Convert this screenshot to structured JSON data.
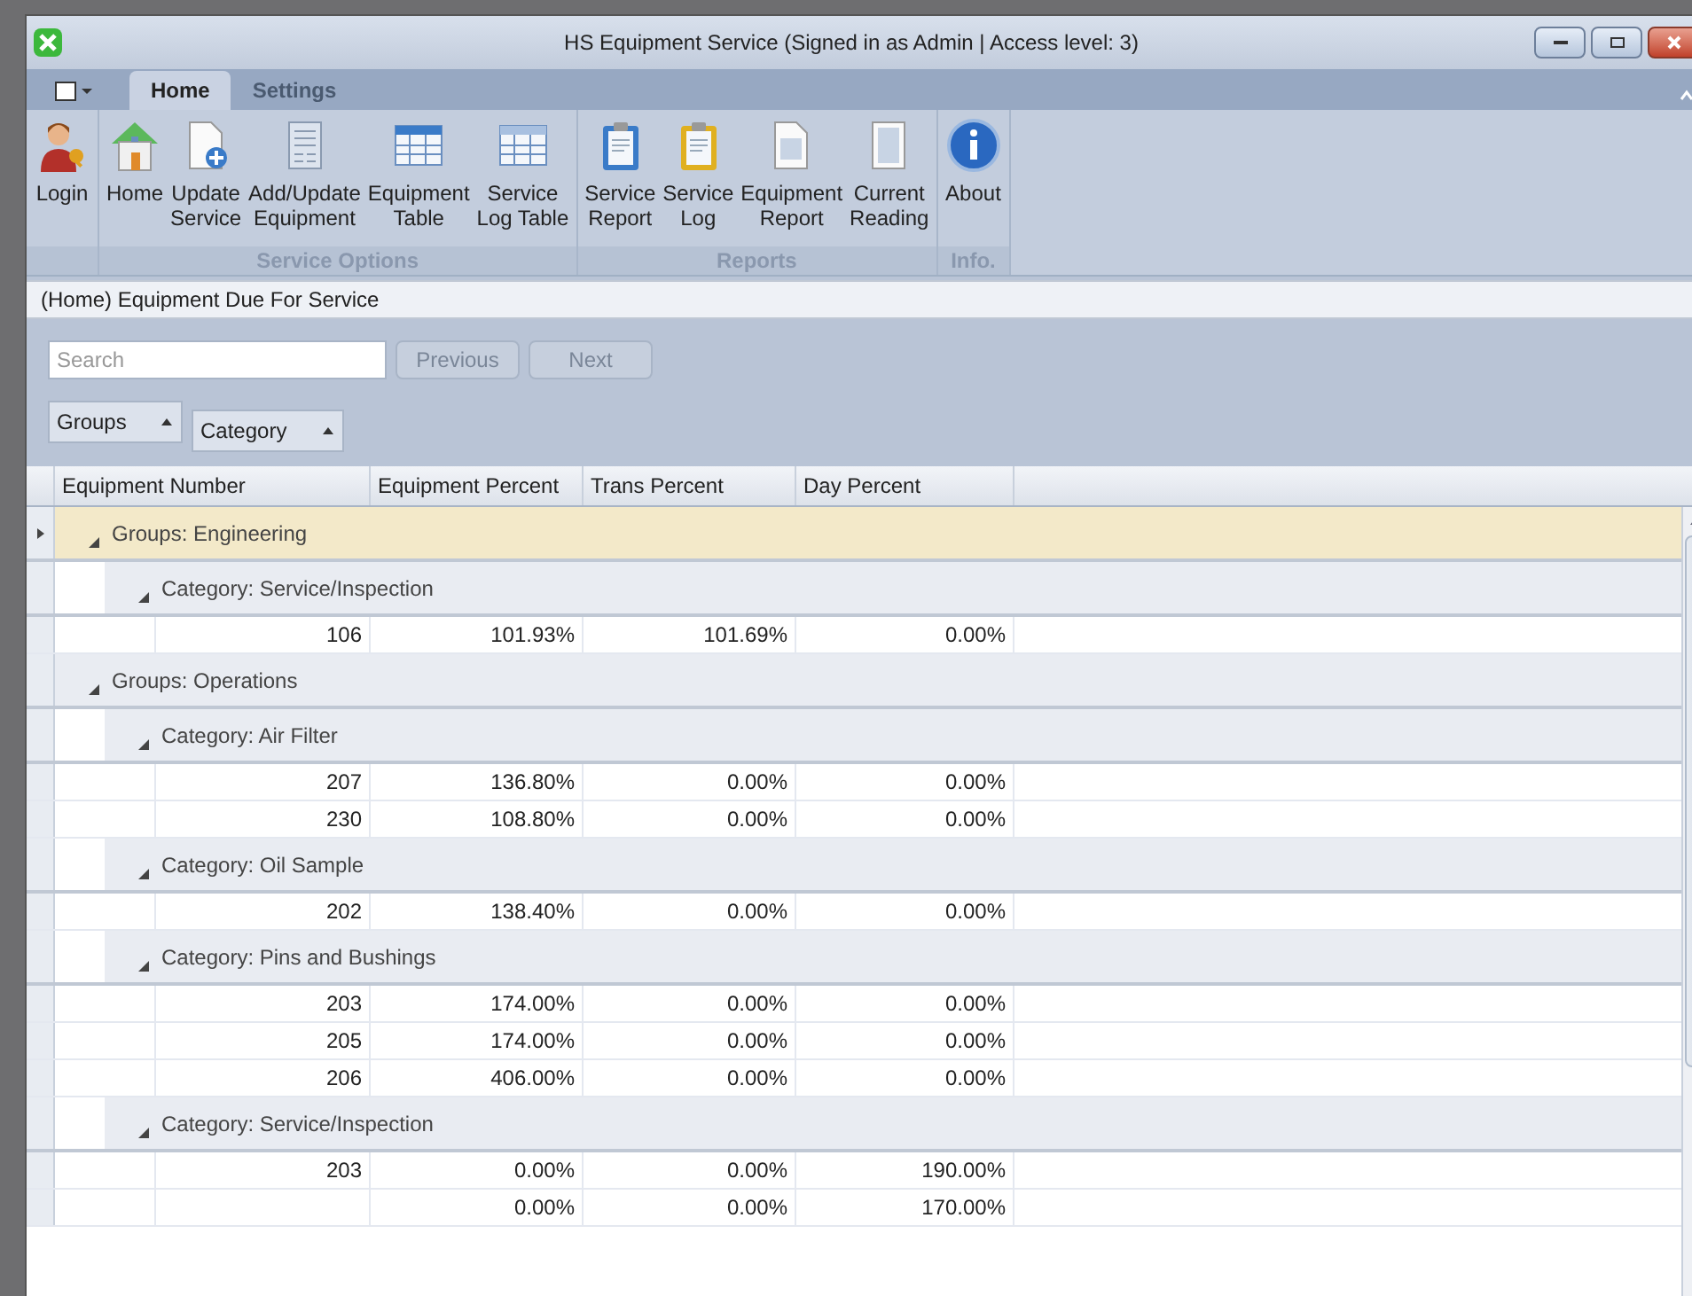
{
  "window": {
    "title": "HS Equipment Service (Signed in as Admin | Access level: 3)"
  },
  "ribbon_tabs": [
    {
      "label": "Home",
      "selected": true
    },
    {
      "label": "Settings",
      "selected": false
    }
  ],
  "ribbon_groups": [
    {
      "buttons": [
        [
          "Login"
        ]
      ]
    },
    {
      "label": "Service Options",
      "buttons": [
        [
          "Home"
        ],
        [
          "Update",
          "Service"
        ],
        [
          "Add/Update",
          "Equipment"
        ],
        [
          "Equipment",
          "Table"
        ],
        [
          "Service",
          "Log Table"
        ]
      ]
    },
    {
      "label": "Reports",
      "buttons": [
        [
          "Service",
          "Report"
        ],
        [
          "Service",
          "Log"
        ],
        [
          "Equipment",
          "Report"
        ],
        [
          "Current",
          "Reading"
        ]
      ]
    },
    {
      "label": "Info.",
      "buttons": [
        [
          "About"
        ]
      ]
    }
  ],
  "breadcrumb": "(Home) Equipment Due For Service",
  "search": {
    "placeholder": "Search"
  },
  "nav_buttons": [
    {
      "label": "Previous",
      "disabled": true
    },
    {
      "label": "Next",
      "disabled": true
    }
  ],
  "group_by": [
    "Groups",
    "Category"
  ],
  "table": {
    "columns": [
      "Equipment Number",
      "Equipment Percent",
      "Trans Percent",
      "Day Percent"
    ],
    "groups": [
      {
        "label": "Groups: Engineering",
        "selected": true,
        "expanded": true,
        "children": [
          {
            "label": "Category: Service/Inspection",
            "expanded": true,
            "rows": [
              [
                "106",
                "101.93%",
                "101.69%",
                "0.00%"
              ]
            ]
          }
        ]
      },
      {
        "label": "Groups: Operations",
        "selected": false,
        "expanded": true,
        "children": [
          {
            "label": "Category: Air Filter",
            "expanded": true,
            "rows": [
              [
                "207",
                "136.80%",
                "0.00%",
                "0.00%"
              ],
              [
                "230",
                "108.80%",
                "0.00%",
                "0.00%"
              ]
            ]
          },
          {
            "label": "Category: Oil Sample",
            "expanded": true,
            "rows": [
              [
                "202",
                "138.40%",
                "0.00%",
                "0.00%"
              ]
            ]
          },
          {
            "label": "Category: Pins and Bushings",
            "expanded": true,
            "rows": [
              [
                "203",
                "174.00%",
                "0.00%",
                "0.00%"
              ],
              [
                "205",
                "174.00%",
                "0.00%",
                "0.00%"
              ],
              [
                "206",
                "406.00%",
                "0.00%",
                "0.00%"
              ]
            ]
          },
          {
            "label": "Category: Service/Inspection",
            "expanded": true,
            "rows": [
              [
                "203",
                "0.00%",
                "0.00%",
                "190.00%"
              ],
              [
                null,
                "0.00%",
                "0.00%",
                "170.00%"
              ]
            ]
          }
        ]
      }
    ]
  }
}
